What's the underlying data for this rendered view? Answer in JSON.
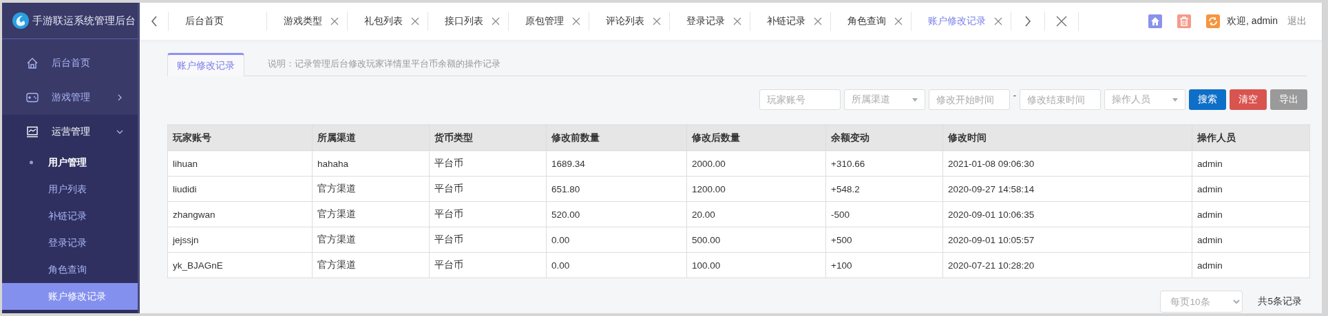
{
  "sidebar": {
    "logo_text": "手游联运系统管理后台",
    "items": [
      {
        "label": "后台首页",
        "kind": "link"
      },
      {
        "label": "游戏管理",
        "kind": "group",
        "expanded": false
      },
      {
        "label": "运营管理",
        "kind": "group",
        "expanded": true,
        "children": [
          {
            "label": "用户管理",
            "kind": "title",
            "selected": false
          },
          {
            "label": "用户列表",
            "kind": "link",
            "selected": false
          },
          {
            "label": "补链记录",
            "kind": "link",
            "selected": false
          },
          {
            "label": "登录记录",
            "kind": "link",
            "selected": false
          },
          {
            "label": "角色查询",
            "kind": "link",
            "selected": false
          },
          {
            "label": "账户修改记录",
            "kind": "link",
            "selected": true
          }
        ]
      }
    ]
  },
  "tabs": [
    {
      "label": "后台首页",
      "closable": false,
      "selected": false
    },
    {
      "label": "游戏类型",
      "closable": true,
      "selected": false
    },
    {
      "label": "礼包列表",
      "closable": true,
      "selected": false
    },
    {
      "label": "接口列表",
      "closable": true,
      "selected": false
    },
    {
      "label": "原包管理",
      "closable": true,
      "selected": false
    },
    {
      "label": "评论列表",
      "closable": true,
      "selected": false
    },
    {
      "label": "登录记录",
      "closable": true,
      "selected": false
    },
    {
      "label": "补链记录",
      "closable": true,
      "selected": false
    },
    {
      "label": "角色查询",
      "closable": true,
      "selected": false
    },
    {
      "label": "账户修改记录",
      "closable": true,
      "selected": true
    }
  ],
  "header": {
    "welcome": "欢迎, admin",
    "logout": "退出"
  },
  "panel": {
    "tab": {
      "label": "账户修改记录",
      "selected": true
    },
    "note": "说明：记录管理后台修改玩家详情里平台币余额的操作记录"
  },
  "filters": [
    {
      "kind": "input",
      "placeholder": "玩家账号"
    },
    {
      "kind": "select",
      "placeholder": "所属渠道"
    },
    {
      "kind": "input",
      "placeholder": "修改开始时间"
    },
    {
      "kind": "separator",
      "text": "-"
    },
    {
      "kind": "input",
      "placeholder": "修改结束时间"
    },
    {
      "kind": "select",
      "placeholder": "操作人员"
    }
  ],
  "buttons": [
    {
      "label": "搜索",
      "kind": "primary"
    },
    {
      "label": "清空",
      "kind": "danger"
    },
    {
      "label": "导出",
      "kind": "default"
    }
  ],
  "table": {
    "columns": [
      "玩家账号",
      "所属渠道",
      "货币类型",
      "修改前数量",
      "修改后数量",
      "余额变动",
      "修改时间",
      "操作人员"
    ],
    "rows": [
      [
        "lihuan",
        "hahaha",
        "平台币",
        "1689.34",
        "2000.00",
        "+310.66",
        "2021-01-08 09:06:30",
        "admin"
      ],
      [
        "liudidi",
        "官方渠道",
        "平台币",
        "651.80",
        "1200.00",
        "+548.2",
        "2020-09-27 14:58:14",
        "admin"
      ],
      [
        "zhangwan",
        "官方渠道",
        "平台币",
        "520.00",
        "20.00",
        "-500",
        "2020-09-01 10:06:35",
        "admin"
      ],
      [
        "jejssjn",
        "官方渠道",
        "平台币",
        "0.00",
        "500.00",
        "+500",
        "2020-09-01 10:05:57",
        "admin"
      ],
      [
        "yk_BJAGnE",
        "官方渠道",
        "平台币",
        "0.00",
        "100.00",
        "+100",
        "2020-07-21 10:28:20",
        "admin"
      ]
    ]
  },
  "pagination": {
    "page_size": "每页10条",
    "total": "共5条记录"
  }
}
